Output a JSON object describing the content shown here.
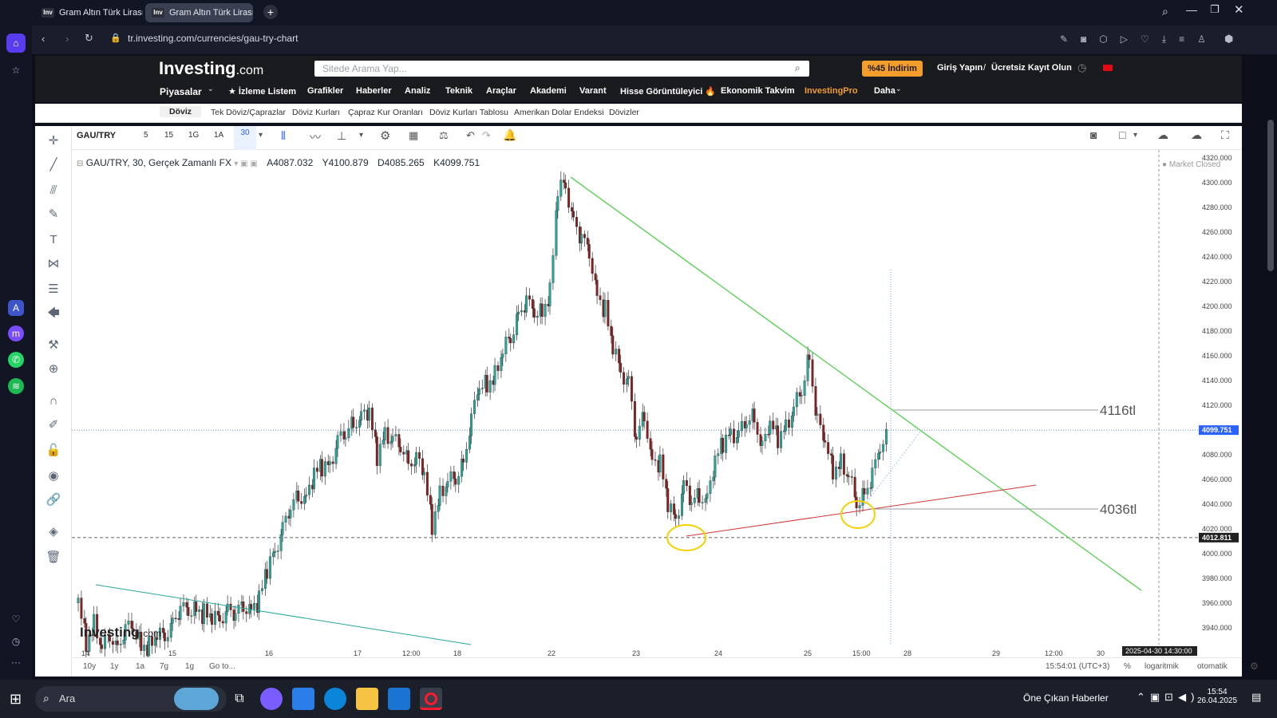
{
  "browser": {
    "tabs": [
      {
        "label": "Gram Altın Türk Lirası Gra",
        "favicon": "Inv"
      },
      {
        "label": "Gram Altın Türk Lirası Gra",
        "favicon": "Inv"
      }
    ],
    "new_tab": "+",
    "url": "tr.investing.com/currencies/gau-try-chart"
  },
  "site": {
    "logo_main": "Investing",
    "logo_suffix": ".com",
    "search_placeholder": "Sitede Arama Yap...",
    "promo": "%45 İndirim",
    "login": "Giriş Yapın",
    "separator": "/",
    "register": "Ücretsiz Kayıt Olun",
    "nav": [
      "Piyasalar",
      "★ İzleme Listem",
      "Grafikler",
      "Haberler",
      "Analiz",
      "Teknik",
      "Araçlar",
      "Akademi",
      "Varant",
      "Hisse Görüntüleyici 🔥",
      "Ekonomik Takvim",
      "InvestingPro",
      "Daha"
    ],
    "subnav": [
      "Döviz",
      "Tek Döviz/Çaprazlar",
      "Döviz Kurları",
      "Çapraz Kur Oranları",
      "Döviz Kurları Tablosu",
      "Amerikan Dolar Endeksi",
      "Dövizler"
    ]
  },
  "chart_toolbar": {
    "symbol": "GAU/TRY",
    "intervals": [
      "5",
      "15",
      "1G",
      "1A",
      "30"
    ],
    "active_interval": "30"
  },
  "legend": {
    "title": "GAU/TRY, 30, Gerçek Zamanlı FX",
    "open": "A4087.032",
    "high": "Y4100.879",
    "low": "D4085.265",
    "close": "K4099.751",
    "status": "Market Closed"
  },
  "chart_data": {
    "type": "candlestick",
    "y_axis_ticks": [
      "4320.000",
      "4300.000",
      "4280.000",
      "4260.000",
      "4240.000",
      "4220.000",
      "4200.000",
      "4180.000",
      "4160.000",
      "4140.000",
      "4120.000",
      "4100.000",
      "4080.000",
      "4060.000",
      "4040.000",
      "4020.000",
      "4000.000",
      "3980.000",
      "3960.000",
      "3940.000"
    ],
    "ylim": [
      3925,
      4325
    ],
    "x_axis_ticks": [
      "14",
      "15",
      "16",
      "17",
      "12:00",
      "18",
      "22",
      "23",
      "24",
      "25",
      "15:00",
      "28",
      "29",
      "12:00",
      "30"
    ],
    "last_price": "4099.751",
    "dashed_level": "4012.811",
    "crosshair_time": "2025-04-30 14:30:00",
    "annotations": [
      {
        "text": "4116tl",
        "level": 4116
      },
      {
        "text": "4036tl",
        "level": 4036
      }
    ],
    "close_path": [
      [
        0,
        3960
      ],
      [
        10,
        3930
      ],
      [
        20,
        3945
      ],
      [
        30,
        3920
      ],
      [
        40,
        3935
      ],
      [
        50,
        3925
      ],
      [
        60,
        3940
      ],
      [
        70,
        3935
      ],
      [
        80,
        3930
      ],
      [
        90,
        3925
      ],
      [
        100,
        3930
      ],
      [
        110,
        3935
      ],
      [
        120,
        3945
      ],
      [
        130,
        3955
      ],
      [
        140,
        3950
      ],
      [
        150,
        3960
      ],
      [
        160,
        3950
      ],
      [
        170,
        3945
      ],
      [
        180,
        3950
      ],
      [
        190,
        3955
      ],
      [
        200,
        3950
      ],
      [
        210,
        3955
      ],
      [
        220,
        3960
      ],
      [
        230,
        3960
      ],
      [
        240,
        3985
      ],
      [
        250,
        4005
      ],
      [
        260,
        4020
      ],
      [
        270,
        4035
      ],
      [
        280,
        4045
      ],
      [
        290,
        4050
      ],
      [
        300,
        4060
      ],
      [
        310,
        4070
      ],
      [
        320,
        4075
      ],
      [
        330,
        4090
      ],
      [
        340,
        4095
      ],
      [
        350,
        4105
      ],
      [
        360,
        4115
      ],
      [
        370,
        4110
      ],
      [
        380,
        4080
      ],
      [
        390,
        4100
      ],
      [
        400,
        4090
      ],
      [
        410,
        4085
      ],
      [
        420,
        4075
      ],
      [
        430,
        4080
      ],
      [
        440,
        4060
      ],
      [
        450,
        4025
      ],
      [
        460,
        4050
      ],
      [
        470,
        4055
      ],
      [
        480,
        4060
      ],
      [
        490,
        4075
      ],
      [
        500,
        4110
      ],
      [
        510,
        4130
      ],
      [
        520,
        4140
      ],
      [
        530,
        4145
      ],
      [
        540,
        4160
      ],
      [
        550,
        4175
      ],
      [
        560,
        4195
      ],
      [
        570,
        4205
      ],
      [
        580,
        4190
      ],
      [
        590,
        4200
      ],
      [
        600,
        4210
      ],
      [
        610,
        4290
      ],
      [
        620,
        4300
      ],
      [
        630,
        4270
      ],
      [
        640,
        4255
      ],
      [
        650,
        4240
      ],
      [
        660,
        4215
      ],
      [
        670,
        4195
      ],
      [
        680,
        4165
      ],
      [
        690,
        4150
      ],
      [
        700,
        4140
      ],
      [
        710,
        4090
      ],
      [
        720,
        4110
      ],
      [
        730,
        4080
      ],
      [
        740,
        4070
      ],
      [
        750,
        4040
      ],
      [
        760,
        4030
      ],
      [
        770,
        4055
      ],
      [
        780,
        4040
      ],
      [
        790,
        4045
      ],
      [
        800,
        4050
      ],
      [
        810,
        4070
      ],
      [
        820,
        4090
      ],
      [
        830,
        4100
      ],
      [
        840,
        4095
      ],
      [
        850,
        4105
      ],
      [
        860,
        4110
      ],
      [
        870,
        4090
      ],
      [
        880,
        4100
      ],
      [
        890,
        4095
      ],
      [
        900,
        4105
      ],
      [
        910,
        4115
      ],
      [
        920,
        4130
      ],
      [
        930,
        4160
      ],
      [
        940,
        4110
      ],
      [
        950,
        4085
      ],
      [
        960,
        4070
      ],
      [
        970,
        4075
      ],
      [
        980,
        4060
      ],
      [
        990,
        4040
      ],
      [
        1000,
        4050
      ],
      [
        1010,
        4065
      ],
      [
        1020,
        4080
      ],
      [
        1030,
        4099.751
      ]
    ]
  }
}
